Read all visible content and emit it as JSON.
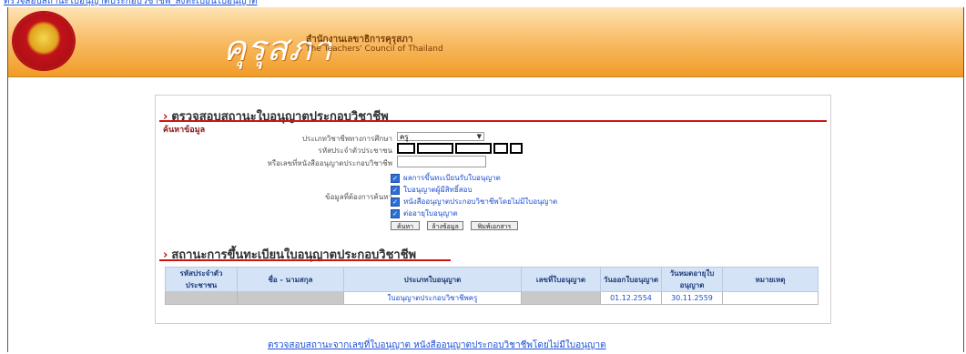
{
  "top_link": "ตรวจสอบสถานะใบอนุญาตประกอบวิชาชีพ_ลงทะเบียนใบอนุญาต",
  "header": {
    "brand_thai": "คุรุสภา",
    "brand_sub1": "สำนักงานเลขาธิการคุรุสภา",
    "brand_sub2": "The Teachers' Council of Thailand"
  },
  "search_section": {
    "title": "ตรวจสอบสถานะใบอนุญาตประกอบวิชาชีพ",
    "subtitle": "ค้นหาข้อมูล",
    "license_type_label": "ประเภทวิชาชีพทางการศึกษา",
    "license_type_value": "ครู",
    "id_label": "รหัสประจำตัวประชาชน",
    "alt_id_label": "หรือเลขที่หนังสืออนุญาตประกอบวิชาชีพ",
    "options_label": "ข้อมูลที่ต้องการค้นหา",
    "options": [
      "ผลการขึ้นทะเบียนรับใบอนุญาต",
      "ใบอนุญาตผู้มีสิทธิ์สอบ",
      "หนังสืออนุญาตประกอบวิชาชีพโดยไม่มีใบอนุญาต",
      "ต่ออายุใบอนุญาต"
    ],
    "buttons": {
      "search": "ค้นหา",
      "clear": "ล้างข้อมูล",
      "print": "พิมพ์เอกสาร"
    }
  },
  "results_section": {
    "title": "สถานะการขึ้นทะเบียนใบอนุญาตประกอบวิชาชีพ",
    "columns": [
      "รหัสประจำตัวประชาชน",
      "ชื่อ - นามสกุล",
      "ประเภทใบอนุญาต",
      "เลขที่ใบอนุญาต",
      "วันออกใบอนุญาต",
      "วันหมดอายุใบอนุญาต",
      "หมายเหตุ"
    ],
    "row": {
      "type": "ใบอนุญาตประกอบวิชาชีพครู",
      "issue_date": "01.12.2554",
      "expiry_date": "30.11.2559"
    }
  },
  "bottom_link": "ตรวจสอบสถานะจากเลขที่ใบอนุญาต หนังสืออนุญาตประกอบวิชาชีพโดยไม่มีใบอนุญาต",
  "colors": {
    "header_orange": "#f19b27",
    "accent_red": "#cc1616",
    "link_blue": "#1a4fd6",
    "table_header": "#d4e3f6"
  }
}
